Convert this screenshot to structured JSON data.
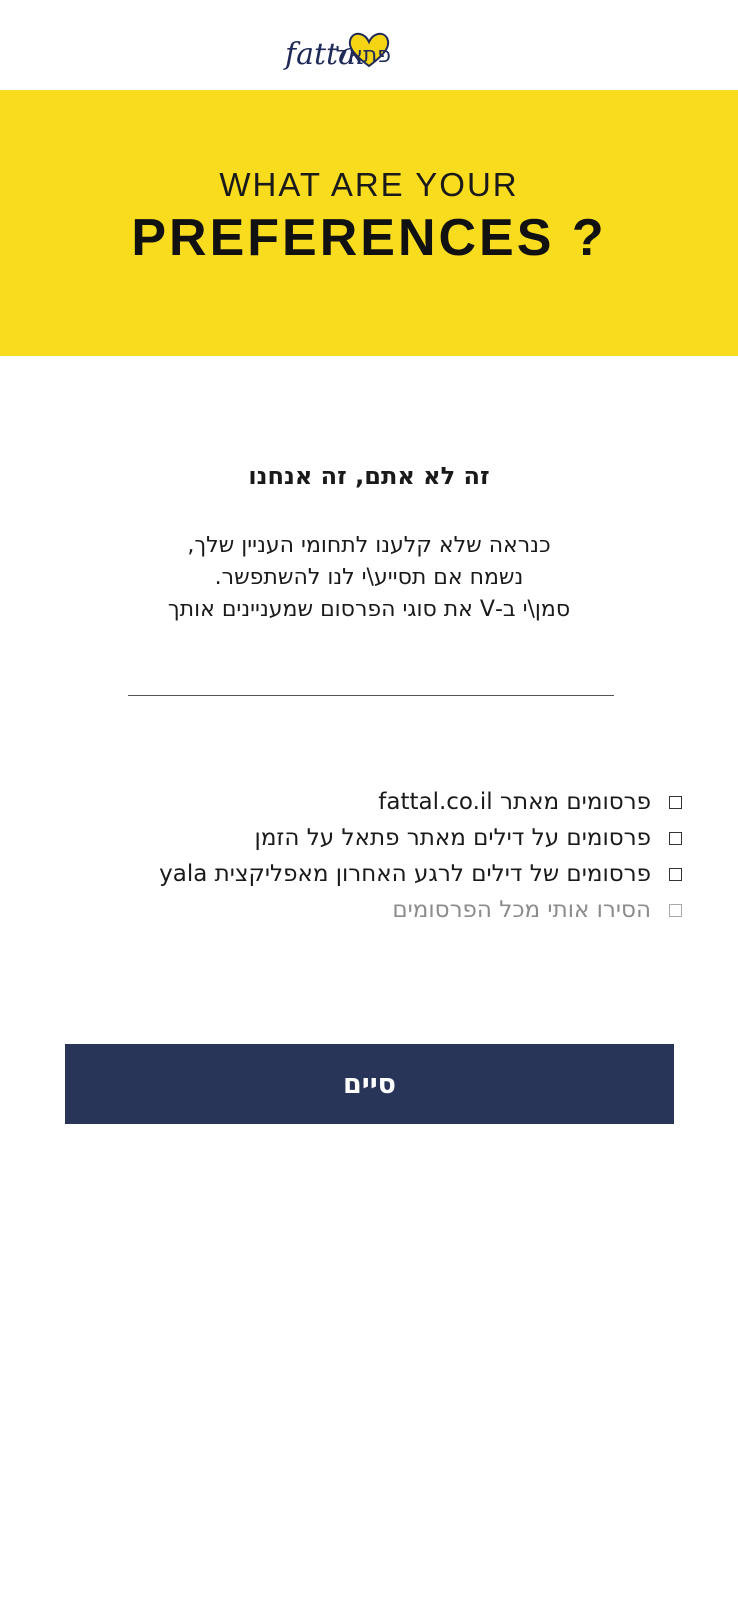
{
  "logo": {
    "latin_text": "fattal",
    "hebrew_text": "פתאל",
    "heart_color": "#f5d414",
    "ink_color": "#1f2a58"
  },
  "hero": {
    "line1": "WHAT ARE YOUR",
    "line2": "PREFERENCES ?",
    "background": "#fadc1e"
  },
  "subtitle": "זה לא אתם, זה אנחנו",
  "description": {
    "line1": "כנראה שלא קלענו לתחומי העניין שלך,",
    "line2": "נשמח אם תסייע\\י לנו להשתפשר.",
    "line3": "סמן\\י ב-V את סוגי הפרסום שמעניינים אותך"
  },
  "options": [
    {
      "label": "פרסומים מאתר fattal.co.il",
      "checked": false,
      "muted": false
    },
    {
      "label": "פרסומים על דילים מאתר פתאל על הזמן",
      "checked": false,
      "muted": false
    },
    {
      "label": "פרסומים של דילים לרגע האחרון מאפליקצית yala",
      "checked": false,
      "muted": false
    },
    {
      "label": "הסירו אותי מכל הפרסומים",
      "checked": false,
      "muted": true
    }
  ],
  "done_button": {
    "label": "סיים",
    "background": "#283458"
  }
}
